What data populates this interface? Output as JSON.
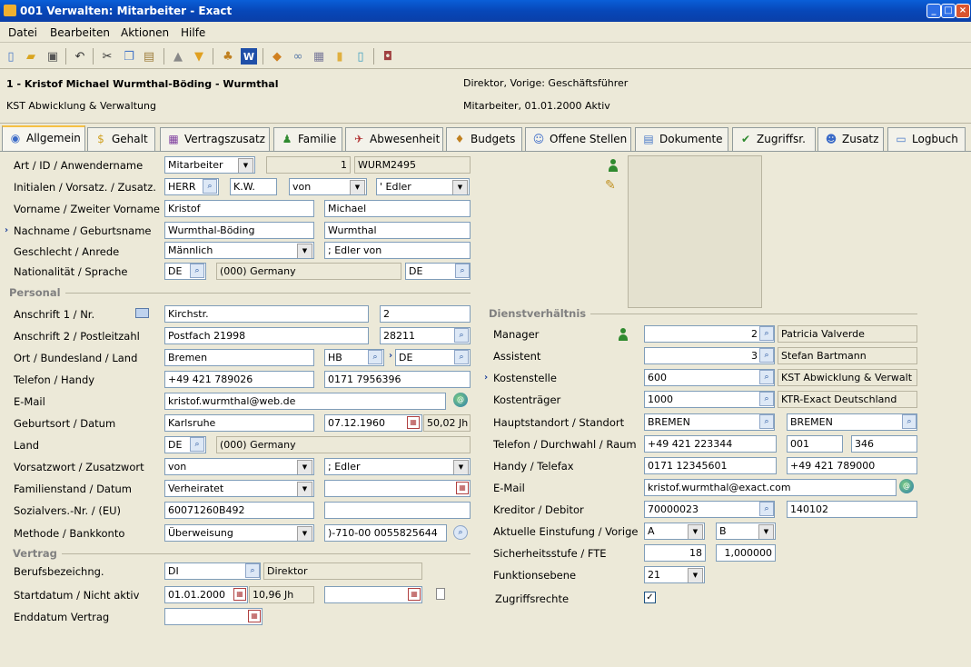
{
  "window": {
    "title": "001 Verwalten: Mitarbeiter - Exact"
  },
  "menu": [
    "Datei",
    "Bearbeiten",
    "Aktionen",
    "Hilfe"
  ],
  "header": {
    "employee": "1 -  Kristof Michael Wurmthal-Böding - Wurmthal",
    "department": "KST Abwicklung & Verwaltung",
    "position": "Direktor, Vorige: Geschäftsführer",
    "status": "Mitarbeiter, 01.01.2000  Aktiv"
  },
  "tabs": [
    "Allgemein",
    "Gehalt",
    "Vertragszusatz",
    "Familie",
    "Abwesenheit",
    "Budgets",
    "Offene Stellen",
    "Dokumente",
    "Zugriffsr.",
    "Zusatz",
    "Logbuch"
  ],
  "general": {
    "labels": {
      "art": "Art / ID / Anwendername",
      "initialen": "Initialen / Vorsatz. / Zusatz.",
      "vorname": "Vorname / Zweiter Vorname",
      "nachname": "Nachname / Geburtsname",
      "geschlecht": "Geschlecht / Anrede",
      "nationalitaet": "Nationalität / Sprache"
    },
    "art": "Mitarbeiter",
    "id": "1",
    "username": "WURM2495",
    "initials": "HERR",
    "initials2": "K.W.",
    "prefix": "von",
    "suffix": "' Edler",
    "firstname": "Kristof",
    "secondname": "Michael",
    "lastname": "Wurmthal-Böding",
    "birthname": "Wurmthal",
    "gender": "Männlich",
    "salutation": "; Edler von",
    "nationality_code": "DE",
    "nationality": "(000) Germany",
    "language": "DE"
  },
  "personal": {
    "section": "Personal",
    "labels": {
      "anschrift1": "Anschrift 1 / Nr.",
      "anschrift2": "Anschrift 2 / Postleitzahl",
      "ort": "Ort / Bundesland / Land",
      "telefon": "Telefon / Handy",
      "email": "E-Mail",
      "geburtsort": "Geburtsort / Datum",
      "land": "Land",
      "vorsatzwort": "Vorsatzwort / Zusatzwort",
      "familienstand": "Familienstand / Datum",
      "sozial": "Sozialvers.-Nr. / (EU)",
      "methode": "Methode / Bankkonto"
    },
    "street": "Kirchstr.",
    "number": "2",
    "address2": "Postfach 21998",
    "zip": "28211",
    "city": "Bremen",
    "state": "HB",
    "country": "DE",
    "phone": "+49 421 789026",
    "mobile": "0171 7956396",
    "email": "kristof.wurmthal@web.de",
    "birthplace": "Karlsruhe",
    "birthdate": "07.12.1960",
    "age": "50,02 Jh",
    "land_code": "DE",
    "land_name": "(000) Germany",
    "vorsatzwort": "von",
    "zusatzwort": "; Edler",
    "marital": "Verheiratet",
    "marital_date": "",
    "ssn": "60071260B492",
    "ssn_eu": "",
    "method": "Überweisung",
    "bank": ")-710-00 0055825644"
  },
  "contract": {
    "section": "Vertrag",
    "labels": {
      "beruf": "Berufsbezeichng.",
      "start": "Startdatum / Nicht aktiv",
      "end": "Enddatum Vertrag"
    },
    "job_code": "DI",
    "job_name": "Direktor",
    "start_date": "01.01.2000",
    "years": "10,96 Jh",
    "inactive_date": "",
    "end_date": ""
  },
  "employment": {
    "section": "Dienstverhältnis",
    "labels": {
      "manager": "Manager",
      "assistent": "Assistent",
      "kostenstelle": "Kostenstelle",
      "kostentraeger": "Kostenträger",
      "standort": "Hauptstandort / Standort",
      "telefon": "Telefon / Durchwahl / Raum",
      "handy": "Handy / Telefax",
      "email": "E-Mail",
      "kreditor": "Kreditor / Debitor",
      "einstufung": "Aktuelle Einstufung / Vorige",
      "sicherheit": "Sicherheitsstufe / FTE",
      "funktion": "Funktionsebene",
      "zugriff": "Zugriffsrechte"
    },
    "manager_id": "2",
    "manager_name": "Patricia Valverde",
    "assistant_id": "3",
    "assistant_name": "Stefan Bartmann",
    "costcenter": "600",
    "costcenter_name": "KST Abwicklung & Verwalt",
    "costunit": "1000",
    "costunit_name": "KTR-Exact Deutschland",
    "mainsite": "BREMEN",
    "site": "BREMEN",
    "phone": "+49 421 223344",
    "ext": "001",
    "room": "346",
    "mobile": "0171 12345601",
    "fax": "+49 421 789000",
    "email": "kristof.wurmthal@exact.com",
    "creditor": "70000023",
    "debtor": "140102",
    "grade": "A",
    "grade_prev": "B",
    "security": "18",
    "fte": "1,000000",
    "level": "21",
    "access": "✓"
  }
}
